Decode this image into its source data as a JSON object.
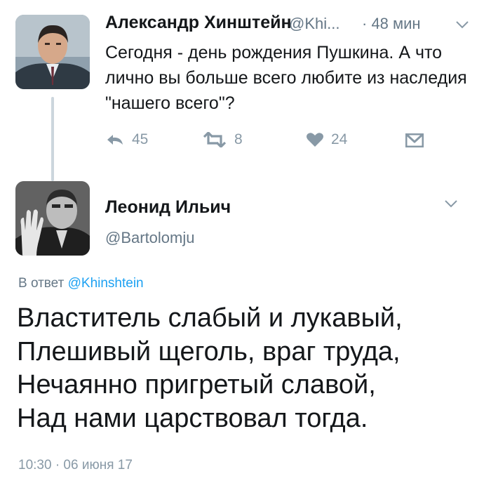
{
  "tweet1": {
    "author_name": "Александр Хинштейн",
    "handle": "@Khi...",
    "time": "· 48 мин",
    "text": "Сегодня - день рождения Пушкина. А что лично вы больше всего любите из наследия \"нашего всего\"?",
    "actions": {
      "reply_count": "45",
      "retweet_count": "8",
      "like_count": "24"
    }
  },
  "tweet2": {
    "author_name": "Леонид Ильич",
    "handle": "@Bartolomju",
    "reply_prefix": "В ответ ",
    "reply_handle": "@Khinshtein",
    "poem_lines": [
      "Властитель слабый и лукавый,",
      "Плешивый щеголь, враг труда,",
      "Нечаянно пригретый славой,",
      "Над нами царствовал тогда."
    ],
    "timestamp": "10:30 · 06 июня 17"
  },
  "icons": [
    "reply-icon",
    "retweet-icon",
    "like-icon",
    "direct-message-icon",
    "chevron-down-icon"
  ],
  "colors": {
    "secondary_text": "#657786",
    "icon_gray": "#8899a6",
    "link": "#1da1f2",
    "thread_line": "#ccd6dd"
  }
}
